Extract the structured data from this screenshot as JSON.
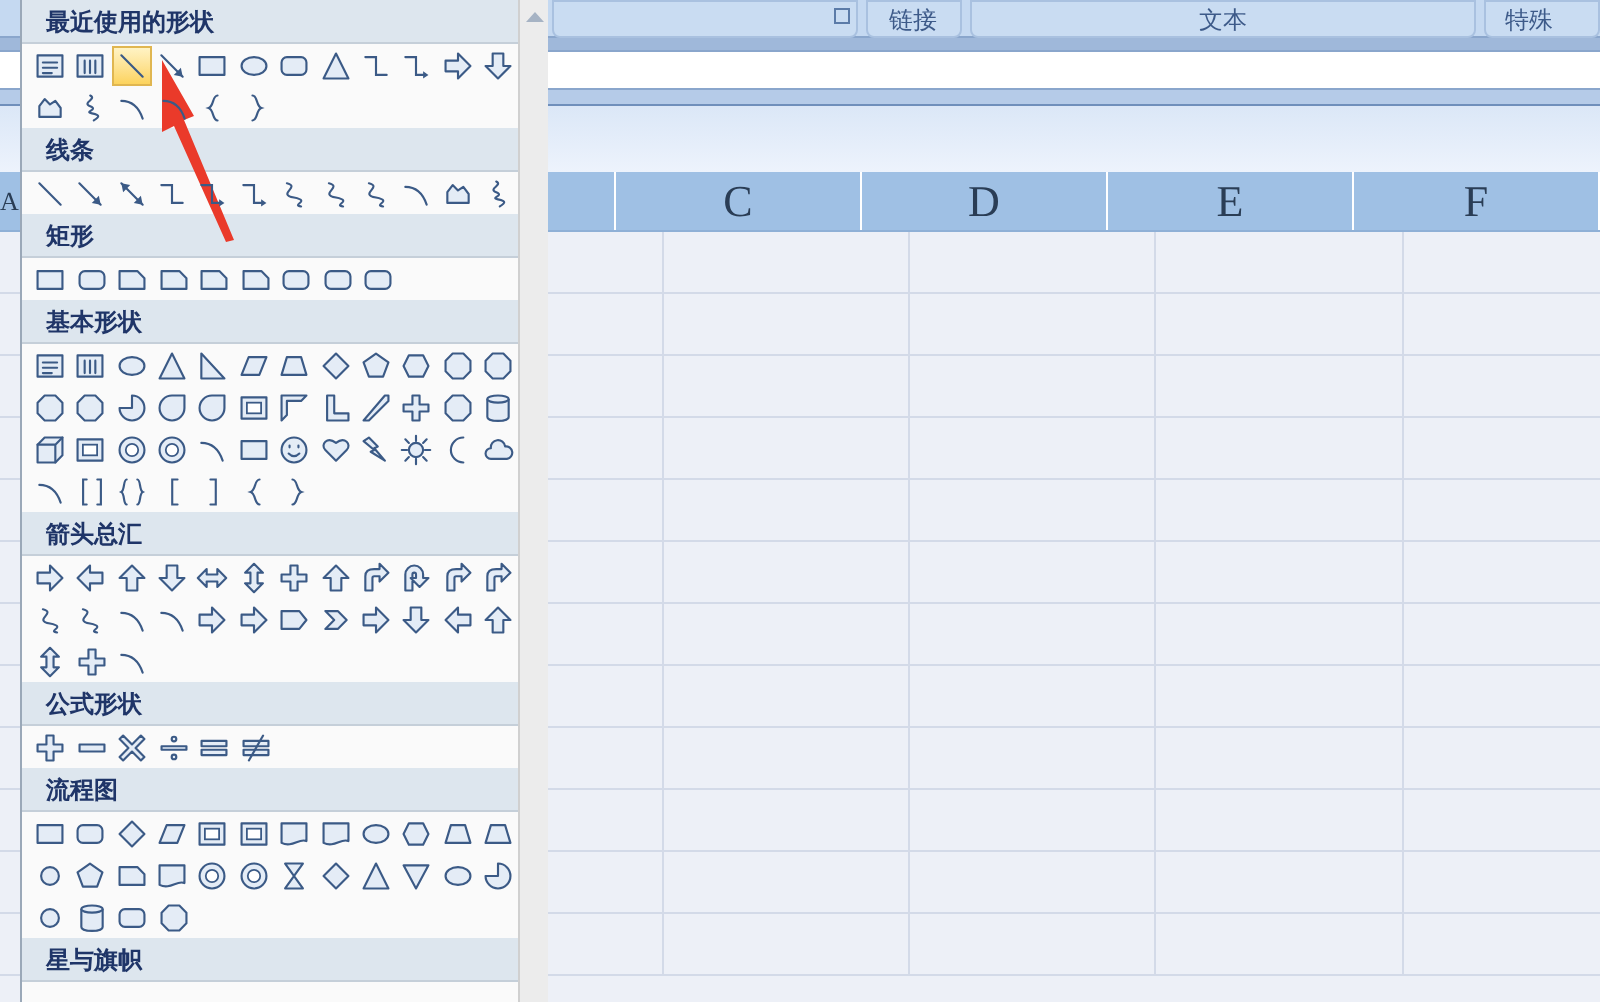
{
  "ribbon": {
    "groups": [
      {
        "label": "链接",
        "launcher": false
      },
      {
        "label": "文本",
        "launcher": false
      },
      {
        "label": "特殊",
        "launcher": false
      }
    ],
    "partial_group": {
      "launcher": true
    }
  },
  "sheet": {
    "columns": [
      "A",
      "C",
      "D",
      "E",
      "F"
    ]
  },
  "shapes_menu": {
    "sections": [
      {
        "title": "最近使用的形状",
        "rows": [
          [
            {
              "kind": "textbox",
              "selected": false
            },
            {
              "kind": "vertical-textbox",
              "selected": false
            },
            {
              "kind": "line",
              "selected": true
            },
            {
              "kind": "arrow-line",
              "selected": false
            },
            {
              "kind": "rect",
              "selected": false
            },
            {
              "kind": "ellipse",
              "selected": false
            },
            {
              "kind": "rounded-rect",
              "selected": false
            },
            {
              "kind": "triangle",
              "selected": false
            },
            {
              "kind": "elbow",
              "selected": false
            },
            {
              "kind": "elbow-arrow",
              "selected": false
            },
            {
              "kind": "arrow-right",
              "selected": false
            },
            {
              "kind": "arrow-down",
              "selected": false
            }
          ],
          [
            {
              "kind": "freeform",
              "selected": false
            },
            {
              "kind": "scribble",
              "selected": false
            },
            {
              "kind": "arc",
              "selected": false
            },
            {
              "kind": "arc",
              "selected": false
            },
            {
              "kind": "brace-left",
              "selected": false
            },
            {
              "kind": "brace-right",
              "selected": false
            }
          ]
        ]
      },
      {
        "title": "线条",
        "rows": [
          [
            {
              "kind": "line",
              "selected": false
            },
            {
              "kind": "arrow-line",
              "selected": false
            },
            {
              "kind": "double-arrow-line",
              "selected": false
            },
            {
              "kind": "elbow",
              "selected": false
            },
            {
              "kind": "elbow-arrow",
              "selected": false
            },
            {
              "kind": "elbow-arrow",
              "selected": false
            },
            {
              "kind": "curve",
              "selected": false
            },
            {
              "kind": "curve",
              "selected": false
            },
            {
              "kind": "curve",
              "selected": false
            },
            {
              "kind": "arc",
              "selected": false
            },
            {
              "kind": "freeform",
              "selected": false
            },
            {
              "kind": "scribble",
              "selected": false
            }
          ]
        ]
      },
      {
        "title": "矩形",
        "rows": [
          [
            {
              "kind": "rect",
              "selected": false
            },
            {
              "kind": "rounded-rect",
              "selected": false
            },
            {
              "kind": "snipped-rect",
              "selected": false
            },
            {
              "kind": "snipped-rect",
              "selected": false
            },
            {
              "kind": "snipped-rect",
              "selected": false
            },
            {
              "kind": "snipped-rect",
              "selected": false
            },
            {
              "kind": "rounded-rect",
              "selected": false
            },
            {
              "kind": "rounded-rect",
              "selected": false
            },
            {
              "kind": "rounded-rect",
              "selected": false
            }
          ]
        ]
      },
      {
        "title": "基本形状",
        "rows": [
          [
            {
              "kind": "textbox",
              "selected": false
            },
            {
              "kind": "vertical-textbox",
              "selected": false
            },
            {
              "kind": "ellipse",
              "selected": false
            },
            {
              "kind": "triangle",
              "selected": false
            },
            {
              "kind": "right-triangle",
              "selected": false
            },
            {
              "kind": "parallelogram",
              "selected": false
            },
            {
              "kind": "trapezoid",
              "selected": false
            },
            {
              "kind": "diamond",
              "selected": false
            },
            {
              "kind": "pentagon",
              "selected": false
            },
            {
              "kind": "hexagon",
              "selected": false
            },
            {
              "kind": "octagon",
              "selected": false
            },
            {
              "kind": "octagon",
              "selected": false
            }
          ],
          [
            {
              "kind": "octagon",
              "selected": false
            },
            {
              "kind": "octagon",
              "selected": false
            },
            {
              "kind": "pie",
              "selected": false
            },
            {
              "kind": "teardrop",
              "selected": false
            },
            {
              "kind": "teardrop",
              "selected": false
            },
            {
              "kind": "frame",
              "selected": false
            },
            {
              "kind": "half-frame",
              "selected": false
            },
            {
              "kind": "l-shape",
              "selected": false
            },
            {
              "kind": "stripe",
              "selected": false
            },
            {
              "kind": "cross",
              "selected": false
            },
            {
              "kind": "octagon",
              "selected": false
            },
            {
              "kind": "can",
              "selected": false
            }
          ],
          [
            {
              "kind": "cube",
              "selected": false
            },
            {
              "kind": "frame",
              "selected": false
            },
            {
              "kind": "donut",
              "selected": false
            },
            {
              "kind": "donut",
              "selected": false
            },
            {
              "kind": "arc",
              "selected": false
            },
            {
              "kind": "rect",
              "selected": false
            },
            {
              "kind": "smiley",
              "selected": false
            },
            {
              "kind": "heart",
              "selected": false
            },
            {
              "kind": "lightning",
              "selected": false
            },
            {
              "kind": "sun",
              "selected": false
            },
            {
              "kind": "moon",
              "selected": false
            },
            {
              "kind": "cloud",
              "selected": false
            }
          ],
          [
            {
              "kind": "arc",
              "selected": false
            },
            {
              "kind": "bracket-pair",
              "selected": false
            },
            {
              "kind": "brace-pair",
              "selected": false
            },
            {
              "kind": "bracket-left",
              "selected": false
            },
            {
              "kind": "bracket-right",
              "selected": false
            },
            {
              "kind": "brace-left",
              "selected": false
            },
            {
              "kind": "brace-right",
              "selected": false
            }
          ]
        ]
      },
      {
        "title": "箭头总汇",
        "rows": [
          [
            {
              "kind": "arrow-right",
              "selected": false
            },
            {
              "kind": "arrow-left",
              "selected": false
            },
            {
              "kind": "arrow-up",
              "selected": false
            },
            {
              "kind": "arrow-down",
              "selected": false
            },
            {
              "kind": "arrow-left-right",
              "selected": false
            },
            {
              "kind": "arrow-up-down",
              "selected": false
            },
            {
              "kind": "cross",
              "selected": false
            },
            {
              "kind": "arrow-up",
              "selected": false
            },
            {
              "kind": "bent-arrow",
              "selected": false
            },
            {
              "kind": "u-turn-arrow",
              "selected": false
            },
            {
              "kind": "bent-arrow",
              "selected": false
            },
            {
              "kind": "bent-arrow",
              "selected": false
            }
          ],
          [
            {
              "kind": "curve",
              "selected": false
            },
            {
              "kind": "curve",
              "selected": false
            },
            {
              "kind": "arc",
              "selected": false
            },
            {
              "kind": "arc",
              "selected": false
            },
            {
              "kind": "arrow-right",
              "selected": false
            },
            {
              "kind": "arrow-right",
              "selected": false
            },
            {
              "kind": "pentagon-arrow",
              "selected": false
            },
            {
              "kind": "chevron",
              "selected": false
            },
            {
              "kind": "arrow-right",
              "selected": false
            },
            {
              "kind": "arrow-down",
              "selected": false
            },
            {
              "kind": "arrow-left",
              "selected": false
            },
            {
              "kind": "arrow-up",
              "selected": false
            }
          ],
          [
            {
              "kind": "arrow-up-down",
              "selected": false
            },
            {
              "kind": "cross",
              "selected": false
            },
            {
              "kind": "arc",
              "selected": false
            }
          ]
        ]
      },
      {
        "title": "公式形状",
        "rows": [
          [
            {
              "kind": "plus",
              "selected": false
            },
            {
              "kind": "minus",
              "selected": false
            },
            {
              "kind": "multiply",
              "selected": false
            },
            {
              "kind": "divide",
              "selected": false
            },
            {
              "kind": "equal",
              "selected": false
            },
            {
              "kind": "not-equal",
              "selected": false
            }
          ]
        ]
      },
      {
        "title": "流程图",
        "rows": [
          [
            {
              "kind": "rect",
              "selected": false
            },
            {
              "kind": "rounded-rect",
              "selected": false
            },
            {
              "kind": "diamond",
              "selected": false
            },
            {
              "kind": "parallelogram",
              "selected": false
            },
            {
              "kind": "frame",
              "selected": false
            },
            {
              "kind": "frame",
              "selected": false
            },
            {
              "kind": "document",
              "selected": false
            },
            {
              "kind": "document",
              "selected": false
            },
            {
              "kind": "ellipse",
              "selected": false
            },
            {
              "kind": "hexagon",
              "selected": false
            },
            {
              "kind": "trapezoid",
              "selected": false
            },
            {
              "kind": "trapezoid",
              "selected": false
            }
          ],
          [
            {
              "kind": "circle",
              "selected": false
            },
            {
              "kind": "pentagon",
              "selected": false
            },
            {
              "kind": "snipped-rect",
              "selected": false
            },
            {
              "kind": "document",
              "selected": false
            },
            {
              "kind": "donut",
              "selected": false
            },
            {
              "kind": "donut",
              "selected": false
            },
            {
              "kind": "hourglass",
              "selected": false
            },
            {
              "kind": "diamond",
              "selected": false
            },
            {
              "kind": "triangle",
              "selected": false
            },
            {
              "kind": "triangle-down",
              "selected": false
            },
            {
              "kind": "ellipse",
              "selected": false
            },
            {
              "kind": "pie",
              "selected": false
            }
          ],
          [
            {
              "kind": "circle",
              "selected": false
            },
            {
              "kind": "can",
              "selected": false
            },
            {
              "kind": "rounded-rect",
              "selected": false
            },
            {
              "kind": "octagon",
              "selected": false
            }
          ]
        ]
      },
      {
        "title": "星与旗帜"
      }
    ]
  }
}
